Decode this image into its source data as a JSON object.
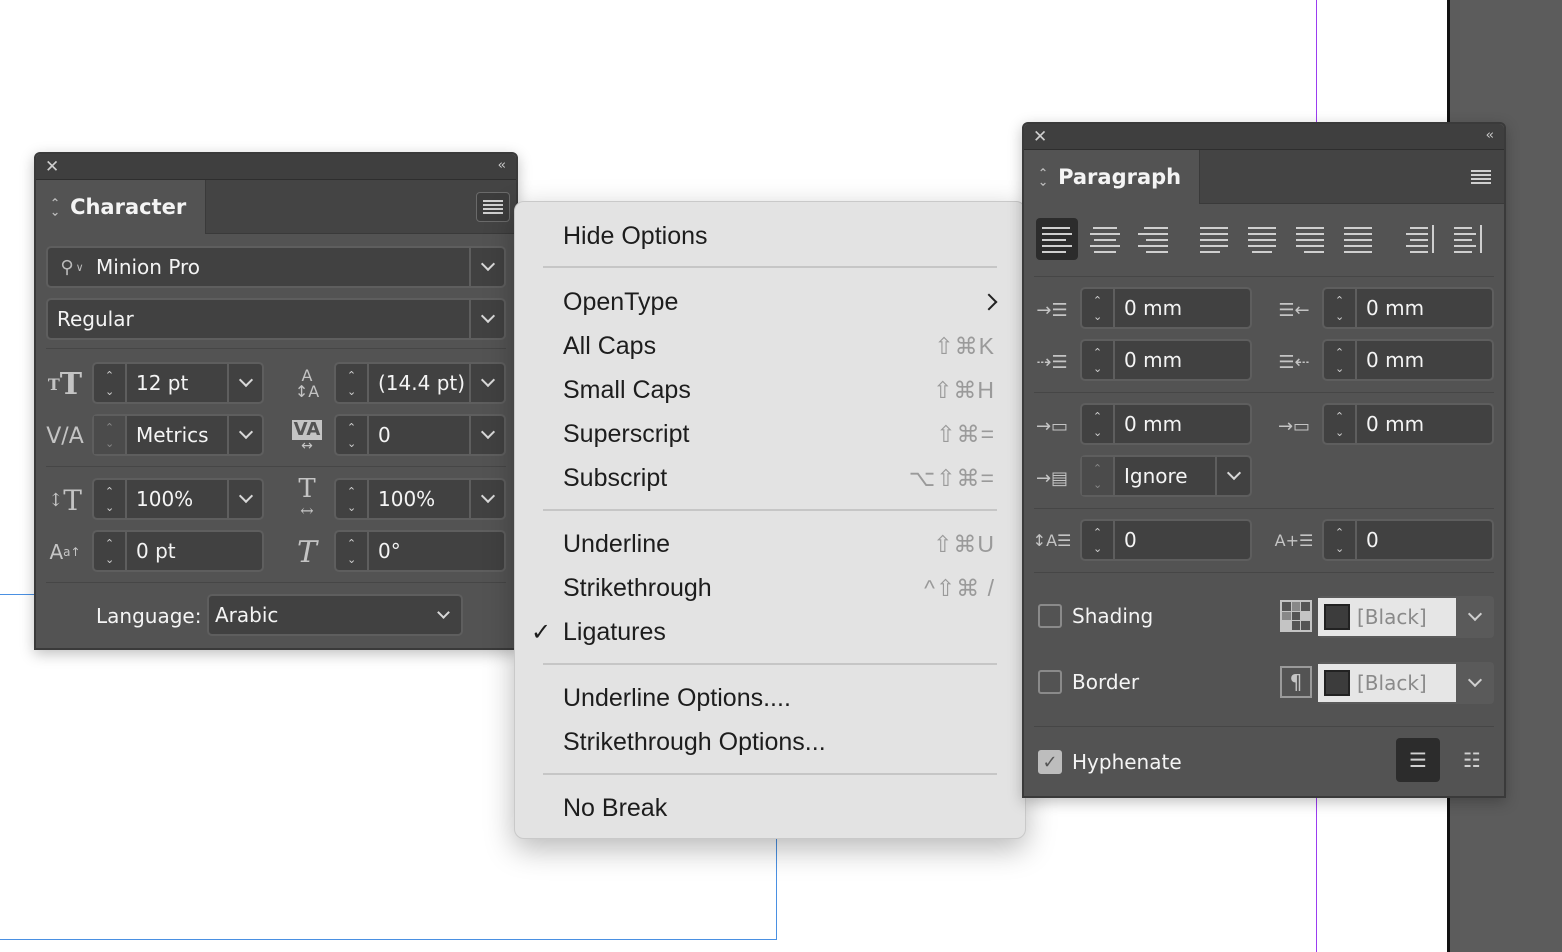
{
  "character_panel": {
    "title": "Character",
    "font_family": "Minion Pro",
    "font_style": "Regular",
    "font_size": "12 pt",
    "leading": "(14.4 pt)",
    "kerning": "Metrics",
    "tracking": "0",
    "vertical_scale": "100%",
    "horizontal_scale": "100%",
    "baseline_shift": "0 pt",
    "skew": "0°",
    "language_label": "Language:",
    "language": "Arabic"
  },
  "context_menu": {
    "items": [
      {
        "label": "Hide Options",
        "shortcut": "",
        "checked": false,
        "submenu": false
      },
      {
        "label": "OpenType",
        "shortcut": "",
        "checked": false,
        "submenu": true
      },
      {
        "label": "All Caps",
        "shortcut": "⇧⌘K",
        "checked": false,
        "submenu": false
      },
      {
        "label": "Small Caps",
        "shortcut": "⇧⌘H",
        "checked": false,
        "submenu": false
      },
      {
        "label": "Superscript",
        "shortcut": "⇧⌘=",
        "checked": false,
        "submenu": false
      },
      {
        "label": "Subscript",
        "shortcut": "⌥⇧⌘=",
        "checked": false,
        "submenu": false
      },
      {
        "label": "Underline",
        "shortcut": "⇧⌘U",
        "checked": false,
        "submenu": false
      },
      {
        "label": "Strikethrough",
        "shortcut": "^⇧⌘ /",
        "checked": false,
        "submenu": false
      },
      {
        "label": "Ligatures",
        "shortcut": "",
        "checked": true,
        "submenu": false
      },
      {
        "label": "Underline Options....",
        "shortcut": "",
        "checked": false,
        "submenu": false
      },
      {
        "label": "Strikethrough Options...",
        "shortcut": "",
        "checked": false,
        "submenu": false
      },
      {
        "label": "No Break",
        "shortcut": "",
        "checked": false,
        "submenu": false
      }
    ],
    "check_glyph": "✓"
  },
  "paragraph_panel": {
    "title": "Paragraph",
    "left_indent": "0 mm",
    "right_indent": "0 mm",
    "first_line_indent": "0 mm",
    "last_line_indent": "0 mm",
    "space_before": "0 mm",
    "space_after": "0 mm",
    "align_to_grid": "Ignore",
    "drop_cap_lines": "0",
    "drop_cap_chars": "0",
    "shading_label": "Shading",
    "shading_checked": false,
    "shading_color": "[Black]",
    "border_label": "Border",
    "border_checked": false,
    "border_color": "[Black]",
    "hyphenate_label": "Hyphenate",
    "hyphenate_checked": true
  },
  "colors": {
    "panel_bg": "#535353",
    "menu_bg": "#e3e3e3",
    "guide_purple": "#9b3df0",
    "frame_blue": "#4a90e2"
  }
}
